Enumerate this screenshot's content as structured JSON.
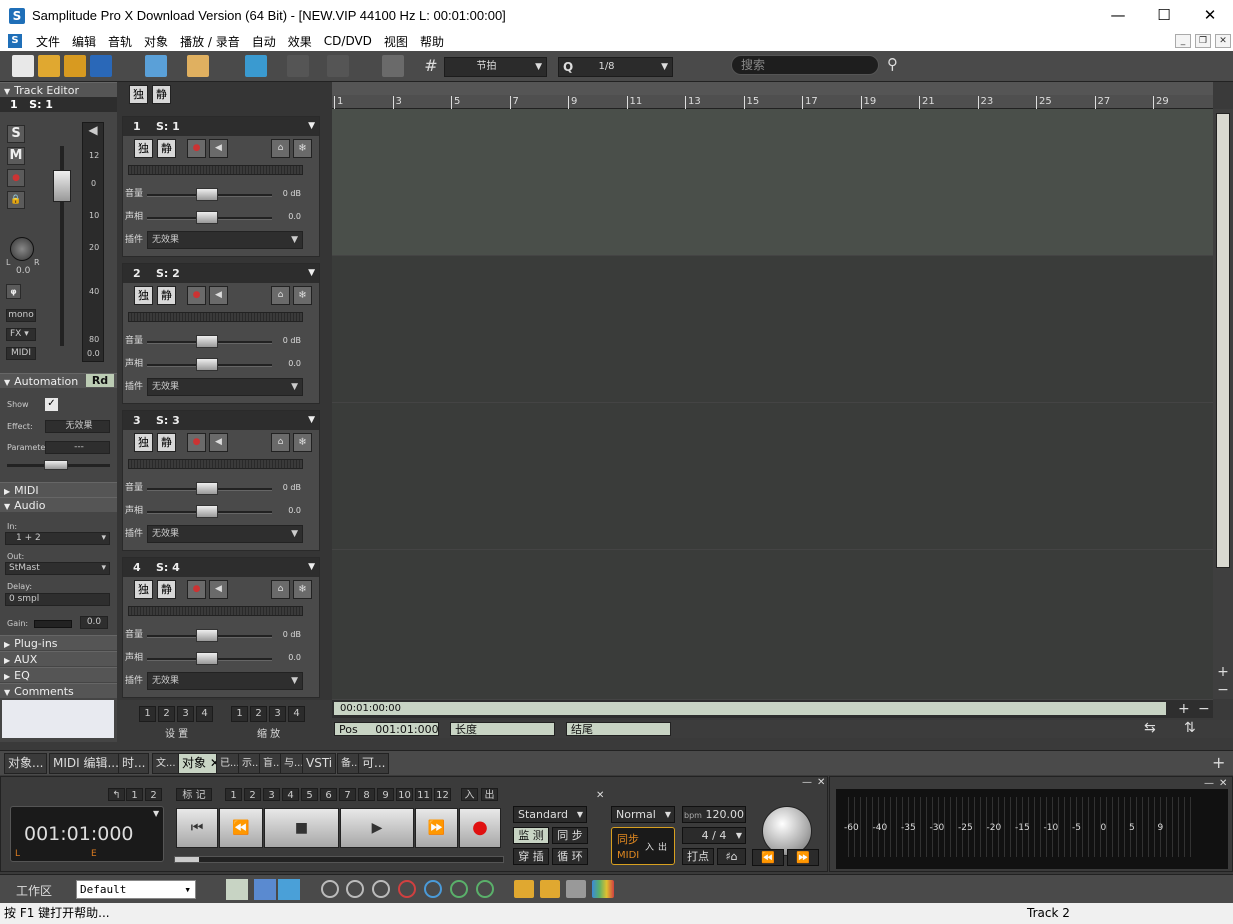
{
  "window": {
    "title": "Samplitude Pro X Download Version (64 Bit) - [NEW.VIP    44100 Hz L: 00:01:00:00]",
    "controls": [
      "—",
      "☐",
      "✕"
    ]
  },
  "menu": [
    "文件",
    "编辑",
    "音轨",
    "对象",
    "播放 / 录音",
    "自动",
    "效果",
    "CD/DVD",
    "视图",
    "帮助"
  ],
  "toolbar": {
    "snap_label": "节拍",
    "quantize_label": "Q",
    "quantize_value": "1/8",
    "search_placeholder": "搜索"
  },
  "inspector": {
    "title": "Track Editor",
    "track_num": "1",
    "track_name": "S: 1",
    "buttons": [
      "S",
      "M"
    ],
    "pan_L": "L",
    "pan_R": "R",
    "pan_value": "0.0",
    "mono": "mono",
    "fx": "FX",
    "midi": "MIDI",
    "meter_scale": [
      "12",
      "0",
      "10",
      "20",
      "40",
      "80",
      "0.0"
    ],
    "automation": "Automation",
    "automation_mode": "Rd",
    "show": "Show",
    "effect_label": "Effect:",
    "effect_value": "无效果",
    "parameter_label": "Parameter:",
    "parameter_value": "---",
    "midi_section": "MIDI",
    "audio_section": "Audio",
    "in_label": "In:",
    "in_value": "1 + 2",
    "out_label": "Out:",
    "out_value": "StMast",
    "delay_label": "Delay:",
    "delay_value": "0 smpl",
    "gain_label": "Gain:",
    "gain_value": "0.0",
    "plugins": "Plug-ins",
    "aux": "AUX",
    "eq": "EQ",
    "comments": "Comments"
  },
  "track_header_top": {
    "solo": "独",
    "mute": "静"
  },
  "tracks": [
    {
      "num": "1",
      "name": "S: 1",
      "solo": "独",
      "mute": "静",
      "vol_label": "音量",
      "vol_value": "0 dB",
      "pan_label": "声相",
      "pan_value": "0.0",
      "plug_label": "插件",
      "plug_value": "无效果"
    },
    {
      "num": "2",
      "name": "S: 2",
      "solo": "独",
      "mute": "静",
      "vol_label": "音量",
      "vol_value": "0 dB",
      "pan_label": "声相",
      "pan_value": "0.0",
      "plug_label": "插件",
      "plug_value": "无效果"
    },
    {
      "num": "3",
      "name": "S: 3",
      "solo": "独",
      "mute": "静",
      "vol_label": "音量",
      "vol_value": "0 dB",
      "pan_label": "声相",
      "pan_value": "0.0",
      "plug_label": "插件",
      "plug_value": "无效果"
    },
    {
      "num": "4",
      "name": "S: 4",
      "solo": "独",
      "mute": "静",
      "vol_label": "音量",
      "vol_value": "0 dB",
      "pan_label": "声相",
      "pan_value": "0.0",
      "plug_label": "插件",
      "plug_value": "无效果"
    }
  ],
  "track_footer": {
    "setup_label": "设 置",
    "zoom_label": "缩 放",
    "nums": [
      "1",
      "2",
      "3",
      "4"
    ]
  },
  "ruler_ticks": [
    "1",
    "3",
    "5",
    "7",
    "9",
    "11",
    "13",
    "15",
    "17",
    "19",
    "21",
    "23",
    "25",
    "27",
    "29"
  ],
  "hbar_time": "00:01:00:00",
  "pos": {
    "label": "Pos",
    "value": "001:01:000",
    "length_label": "长度",
    "end_label": "结尾"
  },
  "dock_tabs": [
    "对象...",
    "MIDI 编辑...",
    "时...",
    "文...",
    "对象",
    "已...",
    "示...",
    "盲...",
    "与...",
    "VSTi",
    "备...",
    "可..."
  ],
  "transport": {
    "time": "001:01:000",
    "L": "L",
    "E": "E",
    "marker_label": "标 记",
    "marker_nums": [
      "1",
      "2",
      "3",
      "4",
      "5",
      "6",
      "7",
      "8",
      "9",
      "10",
      "11",
      "12"
    ],
    "small_nums": [
      "1",
      "2"
    ],
    "in_label": "入",
    "out_label": "出",
    "mode": "Standard",
    "monitor": "监 测",
    "sync": "同 步",
    "punch": "穿 插",
    "loop": "循 环",
    "normal": "Normal",
    "bpm_label": "bpm",
    "bpm": "120.00",
    "sig": "4 / 4",
    "sync_box": "同步",
    "in": "入",
    "out": "出",
    "midi": "MIDI",
    "click": "打点"
  },
  "meter_scale": [
    "-60",
    "-40",
    "-35",
    "-30",
    "-25",
    "-20",
    "-15",
    "-10",
    "-5",
    "0",
    "5",
    "9"
  ],
  "workspace": {
    "label": "工作区",
    "value": "Default"
  },
  "status": {
    "help": "按 F1 键打开帮助...",
    "track": "Track 2"
  }
}
